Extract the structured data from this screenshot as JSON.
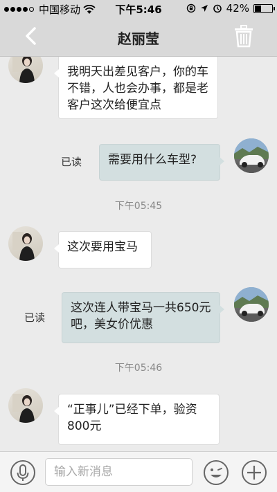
{
  "status_bar": {
    "carrier": "中国移动",
    "time": "下午5:46",
    "battery_percent": "42%",
    "battery_level": 0.42,
    "icons": [
      "signal-dots-icon",
      "wifi-icon",
      "rotation-lock-icon",
      "location-icon",
      "alarm-icon",
      "battery-icon"
    ]
  },
  "header": {
    "title": "赵丽莹",
    "back_icon": "chevron-left-icon",
    "delete_icon": "trash-icon"
  },
  "messages": [
    {
      "side": "left",
      "text": "我明天出差见客户，你的车不错，人也会办事，都是老客户这次给便宜点"
    },
    {
      "side": "right",
      "text": "需要用什么车型?",
      "status": "已读"
    },
    {
      "type": "time",
      "text": "下午05:45"
    },
    {
      "side": "left",
      "text": "这次要用宝马"
    },
    {
      "side": "right",
      "text": "这次连人带宝马一共650元吧，美女价优惠",
      "status": "已读"
    },
    {
      "type": "time",
      "text": "下午05:46"
    },
    {
      "side": "left",
      "text": "“正事儿”已经下单，验资800元"
    }
  ],
  "input_bar": {
    "placeholder": "输入新消息",
    "value": "",
    "voice_icon": "microphone-icon",
    "emoji_icon": "emoji-icon",
    "add_icon": "plus-icon"
  },
  "colors": {
    "header_bg": "#d9d9d9",
    "chat_bg": "#ebebeb",
    "incoming_bubble": "#ffffff",
    "outgoing_bubble": "#d3dfe0"
  }
}
